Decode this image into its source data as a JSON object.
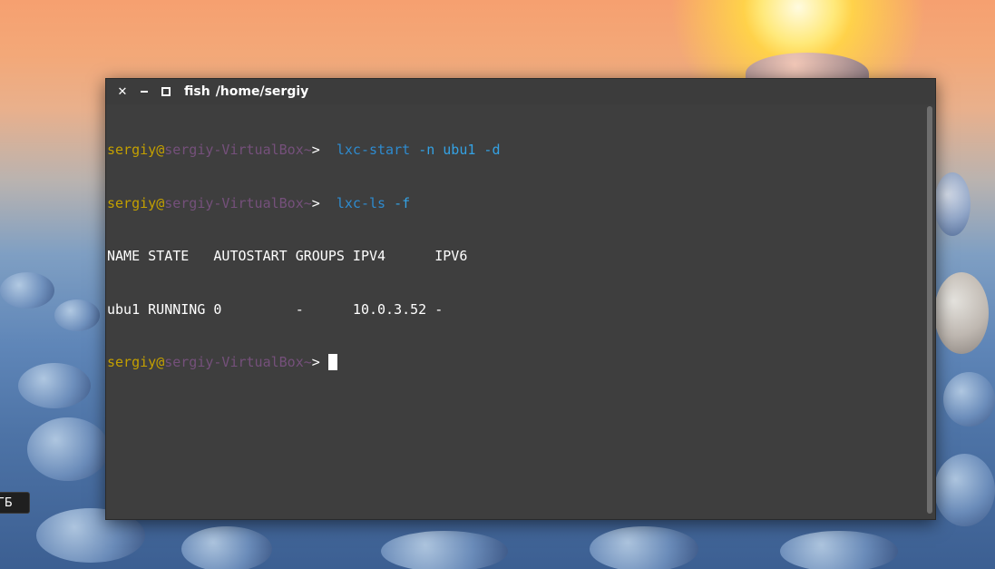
{
  "window": {
    "title_app": "fish",
    "title_path": "/home/sergiy"
  },
  "terminal": {
    "lines": [
      {
        "user": "sergiy",
        "at": "@",
        "host": "sergiy-VirtualBox",
        "tilde": "~",
        "prompt": ">",
        "command": "lxc-start",
        "args": "-n ubu1 -d"
      },
      {
        "user": "sergiy",
        "at": "@",
        "host": "sergiy-VirtualBox",
        "tilde": "~",
        "prompt": ">",
        "command": "lxc-ls",
        "args": "-f"
      }
    ],
    "output_header": "NAME STATE   AUTOSTART GROUPS IPV4      IPV6",
    "output_row": "ubu1 RUNNING 0         -      10.0.3.52 -",
    "current_prompt": {
      "user": "sergiy",
      "at": "@",
      "host": "sergiy-VirtualBox",
      "tilde": "~",
      "prompt": ">"
    }
  },
  "taskbar": {
    "tag_label": "ГБ"
  },
  "icons": [
    "close-icon",
    "minimize-icon",
    "maximize-icon"
  ],
  "colors": {
    "user": "#c4a000",
    "host": "#75507b",
    "command": "#2e8bcf",
    "terminal_bg": "#3e3e3e"
  }
}
